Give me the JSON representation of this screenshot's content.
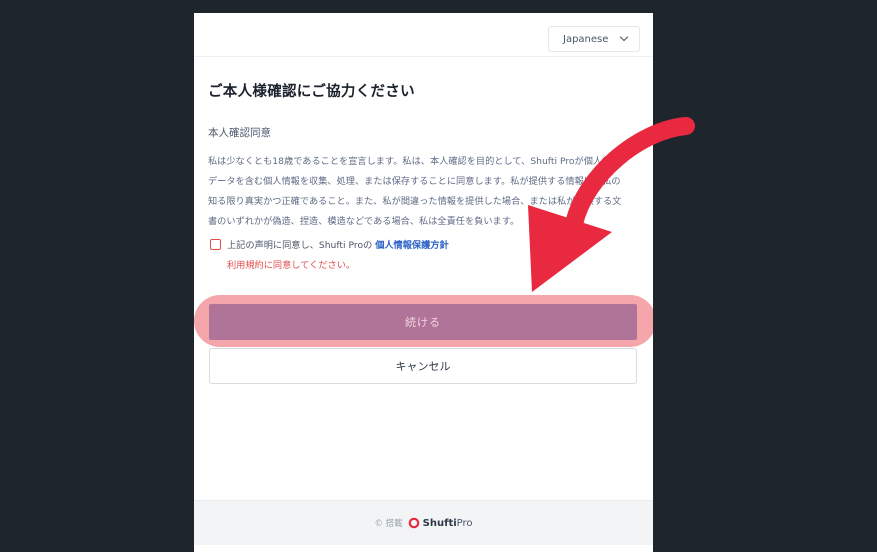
{
  "language_select": {
    "value": "Japanese"
  },
  "heading": "ご本人様確認にご協力ください",
  "consent": {
    "title": "本人確認同意",
    "lines": [
      "私は少なくとも18歳であることを宣言します。私は、本人確認を目的として、Shufti Proが個人認証",
      "データを含む個人情報を収集、処理、または保存することに同意します。私が提供する情報は、私の",
      "知る限り真実かつ正確であること。また、私が間違った情報を提供した場合、または私が提供する文",
      "書のいずれかが偽造、捏造、模造などである場合、私は全責任を負います。"
    ]
  },
  "agreement": {
    "text": "上記の声明に同意し、Shufti Proの",
    "link": "個人情報保護方針",
    "error": "利用規約に同意してください。"
  },
  "buttons": {
    "continue": "続ける",
    "cancel": "キャンセル"
  },
  "footer": {
    "powered": "© 搭載",
    "logo_bold": "Shufti",
    "logo_light": "Pro"
  },
  "colors": {
    "accent": "#b07499",
    "error": "#e24c4c",
    "arrow": "#e8293f",
    "link": "#2f64c9"
  }
}
